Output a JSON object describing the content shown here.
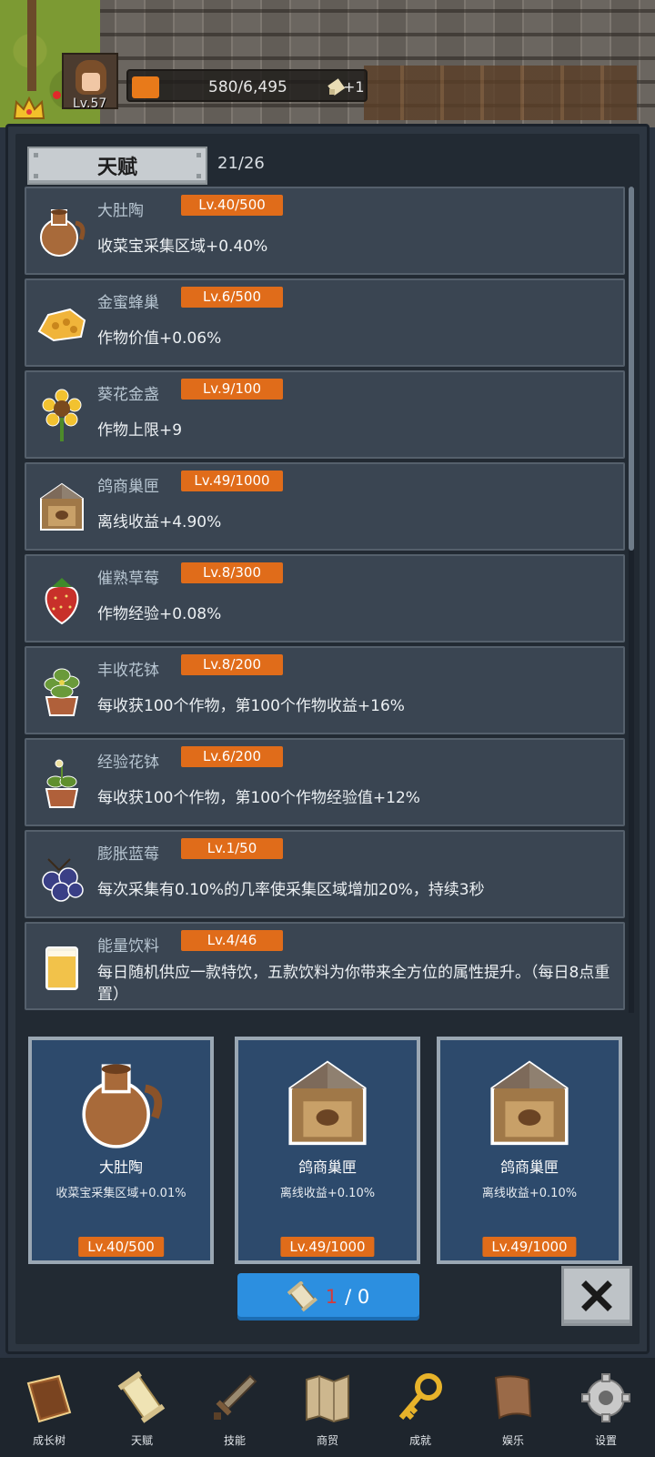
{
  "player": {
    "level": "Lv.57",
    "xp_text": "580/6,495",
    "xp_fraction": 0.089,
    "bonus": "+1"
  },
  "talent": {
    "title": "天赋",
    "count": "21/26",
    "items": [
      {
        "name": "大肚陶",
        "level": "Lv.40/500",
        "desc": "收菜宝采集区域+0.40%",
        "icon": "jug-icon"
      },
      {
        "name": "金蜜蜂巢",
        "level": "Lv.6/500",
        "desc": "作物价值+0.06%",
        "icon": "honeycomb-icon"
      },
      {
        "name": "葵花金盏",
        "level": "Lv.9/100",
        "desc": "作物上限+9",
        "icon": "sunflower-icon"
      },
      {
        "name": "鸽商巢匣",
        "level": "Lv.49/1000",
        "desc": "离线收益+4.90%",
        "icon": "nestbox-icon"
      },
      {
        "name": "催熟草莓",
        "level": "Lv.8/300",
        "desc": "作物经验+0.08%",
        "icon": "strawberry-icon"
      },
      {
        "name": "丰收花钵",
        "level": "Lv.8/200",
        "desc": "每收获100个作物，第100个作物收益+16%",
        "icon": "flowerpot-icon"
      },
      {
        "name": "经验花钵",
        "level": "Lv.6/200",
        "desc": "每收获100个作物，第100个作物经验值+12%",
        "icon": "sprout-pot-icon"
      },
      {
        "name": "膨胀蓝莓",
        "level": "Lv.1/50",
        "desc": "每次采集有0.10%的几率使采集区域增加20%，持续3秒",
        "icon": "blueberry-icon"
      },
      {
        "name": "能量饮料",
        "level": "Lv.4/46",
        "desc": "每日随机供应一款特饮，五款饮料为你带来全方位的属性提升。（每日8点重置）",
        "icon": "drink-icon"
      }
    ]
  },
  "picks": [
    {
      "name": "大肚陶",
      "desc": "收菜宝采集区域+0.01%",
      "level": "Lv.40/500",
      "icon": "jug-icon"
    },
    {
      "name": "鸽商巢匣",
      "desc": "离线收益+0.10%",
      "level": "Lv.49/1000",
      "icon": "nestbox-icon"
    },
    {
      "name": "鸽商巢匣",
      "desc": "离线收益+0.10%",
      "level": "Lv.49/1000",
      "icon": "nestbox-icon"
    }
  ],
  "refresh": {
    "current": "1",
    "rest": "/ 0"
  },
  "nav": [
    {
      "label": "成长树",
      "icon": "book-icon"
    },
    {
      "label": "天赋",
      "icon": "scroll-icon"
    },
    {
      "label": "技能",
      "icon": "sword-icon"
    },
    {
      "label": "商贸",
      "icon": "map-icon"
    },
    {
      "label": "成就",
      "icon": "key-icon"
    },
    {
      "label": "娱乐",
      "icon": "banner-icon"
    },
    {
      "label": "设置",
      "icon": "gear-icon"
    }
  ],
  "colors": {
    "accent": "#e06c1a",
    "button_blue": "#2c8fe0",
    "card_bg": "#3a4552",
    "pick_bg": "#2d4a6c"
  }
}
